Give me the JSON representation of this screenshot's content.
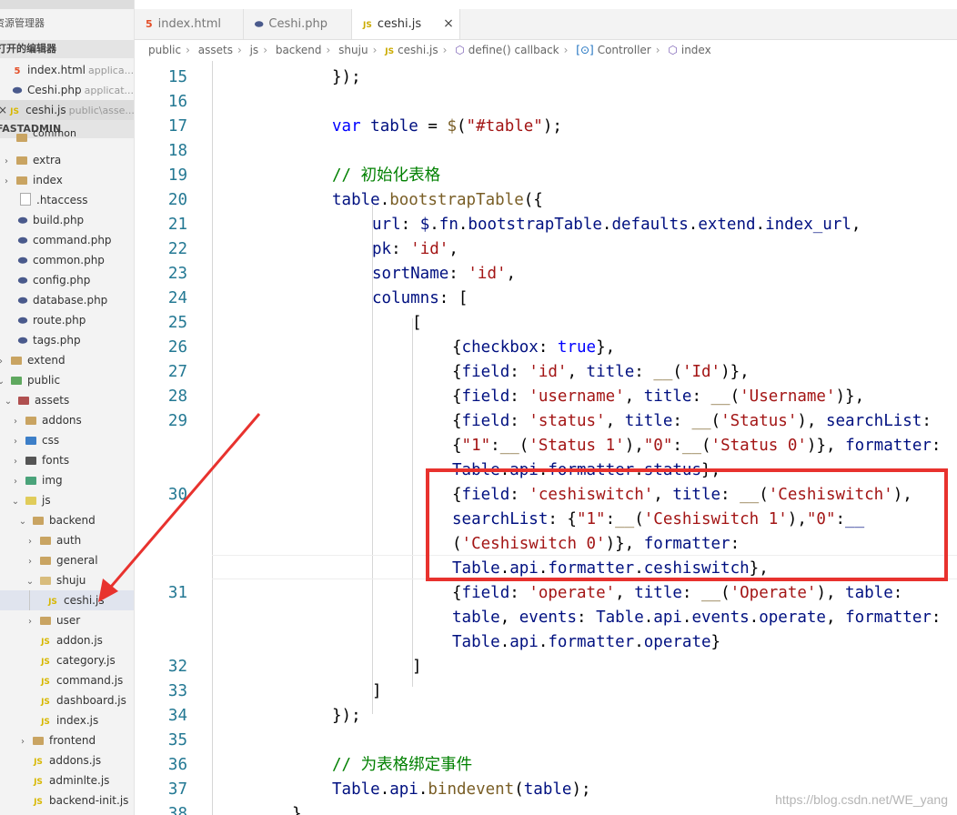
{
  "sidebar": {
    "title": "资源管理器",
    "open_editors_header": "打开的编辑器",
    "open_editors": [
      {
        "icon": "html-icon",
        "name": "index.html",
        "path": "applica..."
      },
      {
        "icon": "php-icon",
        "name": "Ceshi.php",
        "path": "applicat..."
      },
      {
        "icon": "js-icon",
        "name": "ceshi.js",
        "path": "public\\asse...",
        "active": true
      }
    ],
    "project_header": "FASTADMIN",
    "tree": [
      {
        "label": "common"
      },
      {
        "label": "extra"
      },
      {
        "label": "index"
      },
      {
        "label": ".htaccess"
      },
      {
        "label": "build.php"
      },
      {
        "label": "command.php"
      },
      {
        "label": "common.php"
      },
      {
        "label": "config.php"
      },
      {
        "label": "database.php"
      },
      {
        "label": "route.php"
      },
      {
        "label": "tags.php"
      },
      {
        "label": "extend"
      },
      {
        "label": "public"
      },
      {
        "label": "assets"
      },
      {
        "label": "addons"
      },
      {
        "label": "css"
      },
      {
        "label": "fonts"
      },
      {
        "label": "img"
      },
      {
        "label": "js"
      },
      {
        "label": "backend"
      },
      {
        "label": "auth"
      },
      {
        "label": "general"
      },
      {
        "label": "shuju"
      },
      {
        "label": "ceshi.js",
        "selected": true
      },
      {
        "label": "user"
      },
      {
        "label": "addon.js"
      },
      {
        "label": "category.js"
      },
      {
        "label": "command.js"
      },
      {
        "label": "dashboard.js"
      },
      {
        "label": "index.js"
      },
      {
        "label": "frontend"
      },
      {
        "label": "addons.js"
      },
      {
        "label": "adminlte.js"
      },
      {
        "label": "backend-init.js"
      }
    ]
  },
  "tabs": [
    {
      "icon": "html-icon",
      "label": "index.html"
    },
    {
      "icon": "php-icon",
      "label": "Ceshi.php"
    },
    {
      "icon": "js-icon",
      "label": "ceshi.js",
      "active": true,
      "close": "×"
    }
  ],
  "breadcrumb": [
    "public",
    "assets",
    "js",
    "backend",
    "shuju",
    "ceshi.js",
    "define() callback",
    "Controller",
    "index"
  ],
  "editor": {
    "line_numbers": [
      "15",
      "16",
      "17",
      "18",
      "19",
      "20",
      "21",
      "22",
      "23",
      "24",
      "25",
      "26",
      "27",
      "28",
      "29",
      "30",
      "31",
      "32",
      "33",
      "34",
      "35",
      "36",
      "37",
      "38"
    ],
    "code": [
      "});",
      "",
      "var table = $(\"#table\");",
      "",
      "// 初始化表格",
      "table.bootstrapTable({",
      "url: $.fn.bootstrapTable.defaults.extend.index_url,",
      "pk: 'id',",
      "sortName: 'id',",
      "columns: [",
      "[",
      "{checkbox: true},",
      "{field: 'id', title: __('Id')},",
      "{field: 'username', title: __('Username')},",
      "{field: 'status', title: __('Status'), searchList:",
      "{\"1\":__('Status 1'),\"0\":__('Status 0')}, formatter:",
      "Table.api.formatter.status},",
      "{field: 'ceshiswitch', title: __('Ceshiswitch'),",
      "searchList: {\"1\":__('Ceshiswitch 1'),\"0\":__",
      "('Ceshiswitch 0')}, formatter:",
      "Table.api.formatter.ceshiswitch},",
      "{field: 'operate', title: __('Operate'), table:",
      "table, events: Table.api.events.operate, formatter:",
      "Table.api.formatter.operate}",
      "]",
      "]",
      "});",
      "",
      "// 为表格绑定事件",
      "Table.api.bindevent(table);",
      "}"
    ]
  },
  "watermark": "https://blog.csdn.net/WE_yang"
}
